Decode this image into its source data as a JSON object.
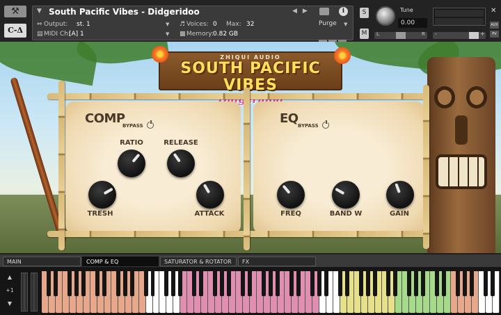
{
  "header": {
    "instrument_name": "South Pacific Vibes - Didgeridoo",
    "output_label": "Output:",
    "output_value": "st. 1",
    "midi_label": "MIDI Ch:",
    "midi_value": "[A]  1",
    "voices_label": "Voices:",
    "voices_value": "0",
    "max_label": "Max:",
    "max_value": "32",
    "memory_label": "Memory:",
    "memory_value": "0.82 GB",
    "purge_label": "Purge",
    "tune_label": "Tune",
    "tune_value": "0.00",
    "solo_label": "S",
    "mute_label": "M",
    "aux_label": "AUX",
    "pv_label": "PV",
    "logo_text": "C-Δ",
    "pan_left": "L",
    "pan_right": "R",
    "vol_minus": "-",
    "vol_plus": "+"
  },
  "instrument": {
    "brand": "ZHIQUI AUDIO",
    "title": "SOUTH PACIFIC VIBES",
    "subtitle": "Didgeridoo",
    "comp": {
      "title": "COMP",
      "bypass": "BYPASS",
      "knobs": [
        "RATIO",
        "RELEASE",
        "TRESH",
        "ATTACK"
      ]
    },
    "eq": {
      "title": "EQ",
      "bypass": "BYPASS",
      "knobs": [
        "FREQ",
        "BAND W",
        "GAIN"
      ]
    }
  },
  "tabs": [
    {
      "label": "MAIN",
      "active": false
    },
    {
      "label": "COMP & EQ",
      "active": true
    },
    {
      "label": "SATURATOR & ROTATOR",
      "active": false
    },
    {
      "label": "FX",
      "active": false
    }
  ],
  "keyboard": {
    "octave_label": "+1",
    "key_colors": {
      "salmon": "#e6a78a",
      "pink": "#e08fb0",
      "yellow": "#e6e08a",
      "green": "#a6d98a",
      "white": "#ffffff"
    }
  }
}
